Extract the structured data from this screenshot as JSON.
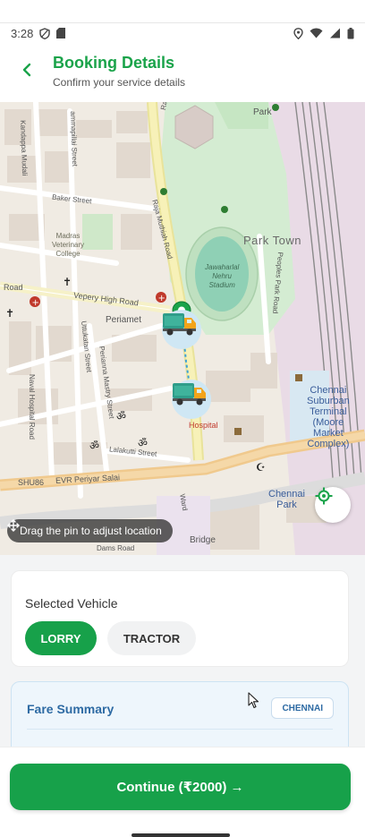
{
  "status_bar": {
    "time": "3:28"
  },
  "header": {
    "title": "Booking Details",
    "subtitle": "Confirm your service details"
  },
  "map": {
    "labels": {
      "kandappa_mudali": "Kandappa Mudali",
      "ammapillai": "ammapillai Street",
      "baker": "Baker Street",
      "raja_muthiah": "Raja Muthiah Road",
      "raja_muth_top": "Raja Muth",
      "park": "Park",
      "park_town": "Park Town",
      "madras_vet": "Madras\nVeterinary\nCollege",
      "jawaharlal": "Jawaharlal\nNehru\nStadium",
      "peoples_park": "Peoples Park Road",
      "road": "Road",
      "vepery": "Vepery High Road",
      "periamet": "Periamet",
      "uttukatan": "Uttukatan Street",
      "perianna": "Perianna Mastry Street",
      "naval": "Naval Hospital Road",
      "lalakutti": "Lalakutti Street",
      "hospital": "Hospital",
      "chennai_central": "Chennai\nSuburban\nTerminal\n(Moore\nMarket\nComplex)",
      "shu86": "SHU86",
      "evr": "EVR Periyar Salai",
      "chennai_park": "Chennai\nPark",
      "bridge": "Bridge",
      "ward": "Ward",
      "dams": "Dams Road"
    },
    "drag_hint": "Drag the pin to adjust location"
  },
  "vehicle": {
    "title": "Selected Vehicle",
    "options": [
      "LORRY",
      "TRACTOR"
    ],
    "selected": "LORRY"
  },
  "fare": {
    "title": "Fare Summary",
    "city": "CHENNAI"
  },
  "footer": {
    "continue_label": "Continue (₹2000) →"
  },
  "colors": {
    "primary": "#17a14a",
    "fare_accent": "#2d6aa3"
  },
  "icons": [
    "back-arrow-icon",
    "location-pin-icon",
    "locate-crosshair-icon",
    "move-icon",
    "truck-icon"
  ]
}
